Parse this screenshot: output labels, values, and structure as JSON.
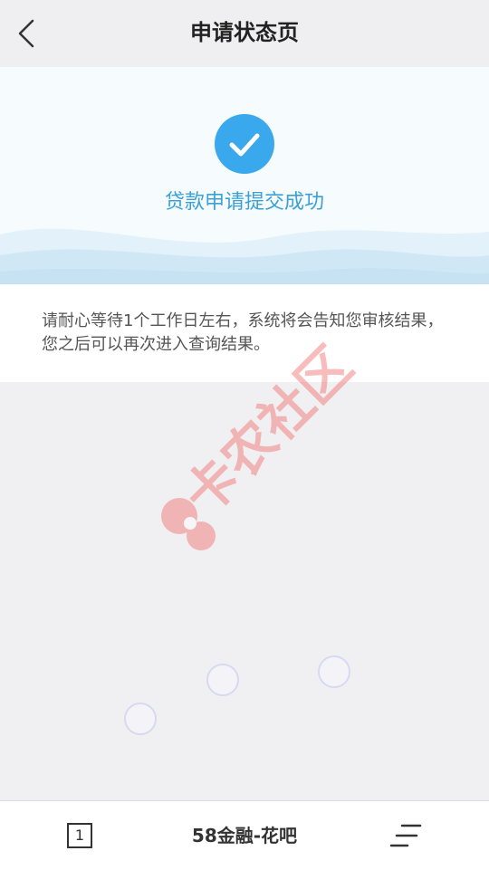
{
  "header": {
    "title": "申请状态页",
    "back_icon": "chevron-left-icon"
  },
  "status": {
    "icon": "check-icon",
    "text": "贷款申请提交成功",
    "accent_color": "#3aa8ec"
  },
  "message": {
    "text": "请耐心等待1个工作日左右，系统将会告知您审核结果，您之后可以再次进入查询结果。"
  },
  "watermark": {
    "text": "卡农社区"
  },
  "bottom_bar": {
    "tab_count": "1",
    "app_title": "58金融-花吧",
    "menu_icon": "menu-icon"
  }
}
